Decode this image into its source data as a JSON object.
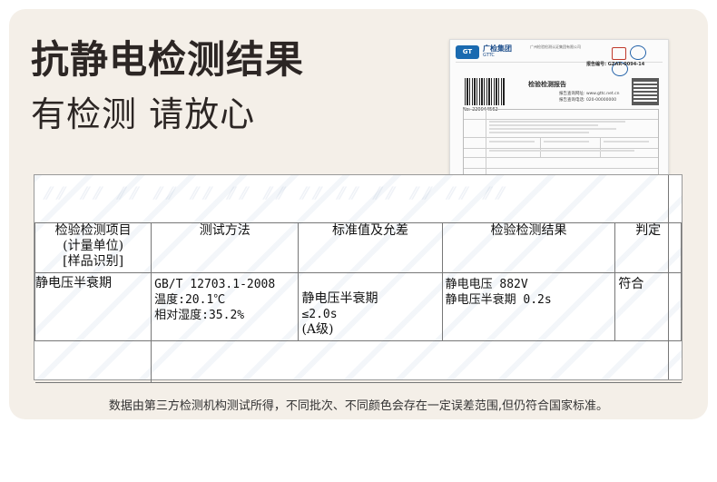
{
  "page": {
    "title": "抗静电检测结果",
    "subtitle": "有检测 请放心",
    "footnote": "数据由第三方检测机构测试所得，不同批次、不同颜色会存在一定误差范围,但仍符合国家标准。"
  },
  "report": {
    "org_short": "广检集团",
    "org_en": "GTTC",
    "org_full": "广州检验检测认证集团有限公司",
    "report_no": "报告编号: GZAR-0094-14",
    "title": "检验检测报告",
    "barcode_no": "No: 220044562",
    "lines": [
      "报告查询网址: www.gttc.net.cn",
      "报告查询电话: 020-00000000"
    ]
  },
  "table": {
    "headers": [
      "检验检测项目\n(计量单位)\n[样品识别]",
      "测试方法",
      "标准值及允差",
      "检验检测结果",
      "判定"
    ],
    "rows": [
      {
        "item": "静电压半衰期",
        "method": [
          "GB/T 12703.1-2008",
          "温度:20.1℃",
          "相对湿度:35.2%"
        ],
        "standard": [
          "静电压半衰期",
          "≤2.0s",
          "(A级)"
        ],
        "result": [
          "静电电压 882V",
          "静电压半衰期 0.2s"
        ],
        "verdict": "符合"
      }
    ]
  },
  "colors": {
    "card_bg": "#f4efe8",
    "title_text": "#2c2624"
  }
}
